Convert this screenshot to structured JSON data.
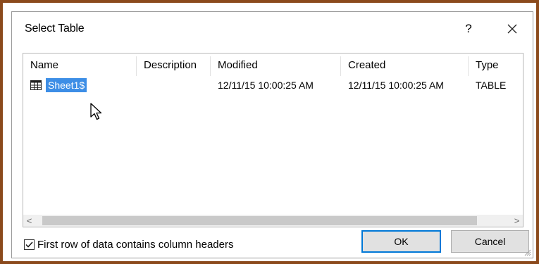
{
  "dialog": {
    "title": "Select Table",
    "help_label": "?",
    "close_glyph": "close-icon"
  },
  "table": {
    "columns": [
      "Name",
      "Description",
      "Modified",
      "Created",
      "Type"
    ],
    "rows": [
      {
        "name": "Sheet1$",
        "description": "",
        "modified": "12/11/15 10:00:25 AM",
        "created": "12/11/15 10:00:25 AM",
        "type": "TABLE",
        "selected": true,
        "icon": "table-grid-icon"
      }
    ]
  },
  "scrollbar": {
    "left_arrow": "<",
    "right_arrow": ">"
  },
  "options": {
    "first_row_headers_label": "First row of data contains column headers",
    "first_row_headers_checked": true
  },
  "buttons": {
    "ok_label": "OK",
    "cancel_label": "Cancel"
  },
  "colors": {
    "frame_border": "#8b4a1c",
    "selection": "#3d8ee6",
    "ok_focus": "#0078d7"
  }
}
